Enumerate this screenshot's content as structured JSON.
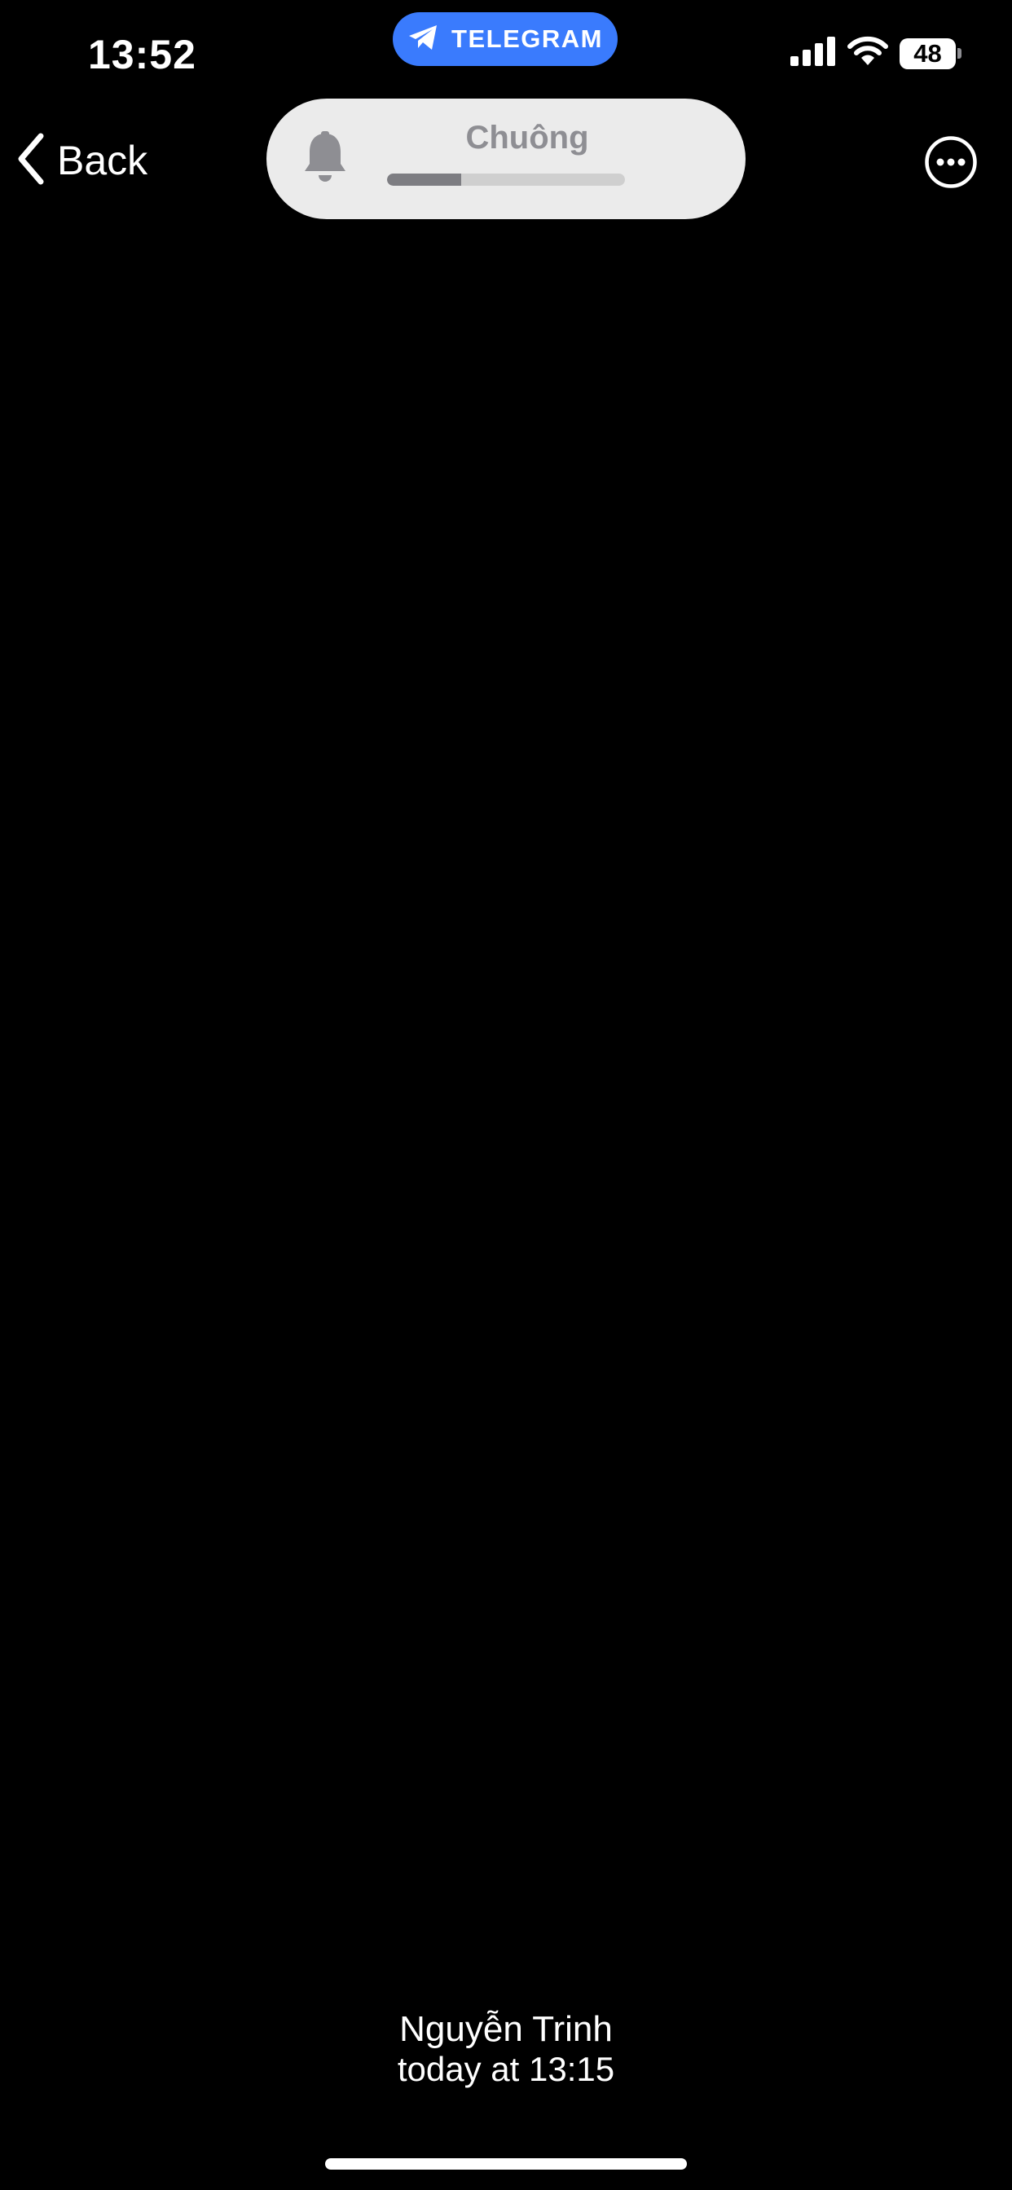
{
  "status_bar": {
    "time": "13:52",
    "active_app": "TELEGRAM",
    "battery_level": "48",
    "icons": [
      "cellular-signal-icon",
      "wifi-icon",
      "battery-icon"
    ]
  },
  "nav": {
    "back_label": "Back",
    "back_icon": "chevron-left-icon",
    "more_icon": "ellipsis-circle-icon"
  },
  "volume_hud": {
    "label": "Chuông",
    "icon": "bell-icon",
    "level": 0.31
  },
  "media": {
    "sender": "Nguyễn Trinh",
    "timestamp": "today at 13:15"
  },
  "colors": {
    "background": "#000000",
    "telegram_pill": "#3a7bfd",
    "hud_background": "#ebebeb",
    "hud_fill": "#7d7d82",
    "hud_track": "#cfcfcf"
  }
}
